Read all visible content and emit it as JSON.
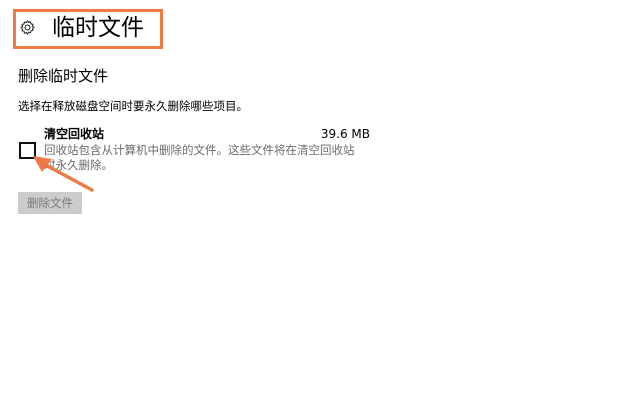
{
  "header": {
    "title": "临时文件",
    "icon": "gear-icon"
  },
  "section": {
    "title": "删除临时文件",
    "description": "选择在释放磁盘空间时要永久删除哪些项目。"
  },
  "items": [
    {
      "name": "清空回收站",
      "size": "39.6 MB",
      "description_line1": "回收站包含从计算机中删除的文件。这些文件将在清空回收站",
      "description_line2": "时永久删除。",
      "checked": false
    }
  ],
  "actions": {
    "delete_label": "删除文件"
  },
  "colors": {
    "highlight": "#f07a45",
    "disabled_button_bg": "#cccccc",
    "disabled_button_text": "#7a7a7a",
    "secondary_text": "#6a6a6a"
  }
}
